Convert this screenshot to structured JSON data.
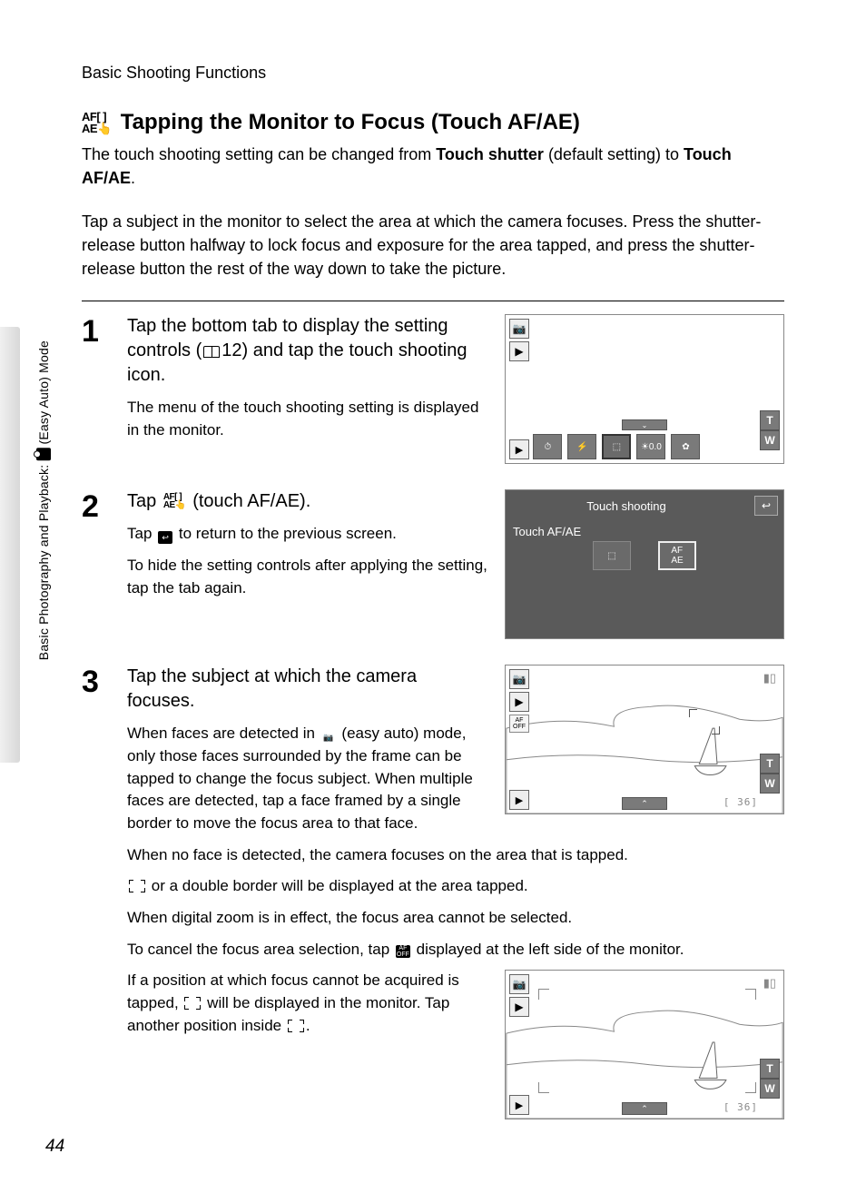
{
  "header": "Basic Shooting Functions",
  "title_icon": "AF[ ]\nAE",
  "title": "Tapping the Monitor to Focus (Touch AF/AE)",
  "intro_part1": "The touch shooting setting can be changed from ",
  "intro_bold1": "Touch shutter",
  "intro_part2": " (default setting) to ",
  "intro_bold2": "Touch AF/AE",
  "intro_part3": ".",
  "intro2": "Tap a subject in the monitor to select the area at which the camera focuses. Press the shutter-release button halfway to lock focus and exposure for the area tapped, and press the shutter-release button the rest of the way down to take the picture.",
  "step1": {
    "head_a": "Tap the bottom tab to display the setting controls (",
    "head_ref": "12",
    "head_b": ") and tap the touch shooting icon.",
    "desc": "The menu of the touch shooting setting is displayed in the monitor."
  },
  "step2": {
    "head_a": "Tap ",
    "head_b": " (touch AF/AE).",
    "desc1a": "Tap ",
    "desc1b": " to return to the previous screen.",
    "desc2": "To hide the setting controls after applying the setting, tap the tab again."
  },
  "step3": {
    "head": "Tap the subject at which the camera focuses.",
    "desc1a": "When faces are detected in ",
    "desc1b": " (easy auto) mode, only those faces surrounded by the frame can be tapped to change the focus subject. When multiple faces are detected, tap a face framed by a single border to move the focus area to that face.",
    "desc2": "When no face is detected, the camera focuses on the area that is tapped.",
    "desc3": " or a double border will be displayed at the area tapped.",
    "desc4": "When digital zoom is in effect, the focus area cannot be selected.",
    "desc5a": "To cancel the focus area selection, tap ",
    "desc5b": " displayed at the left side of the monitor.",
    "desc6a": "If a position at which focus cannot be acquired is tapped, ",
    "desc6b": " will be displayed in the monitor. Tap another position inside ",
    "desc6c": "."
  },
  "ss2": {
    "title": "Touch shooting",
    "label": "Touch AF/AE"
  },
  "ss3": {
    "counter": "[   36]",
    "zoom_t": "T",
    "zoom_w": "W"
  },
  "sidebar_a": "Basic Photography and Playback: ",
  "sidebar_b": " (Easy Auto) Mode",
  "pagenum": "44"
}
